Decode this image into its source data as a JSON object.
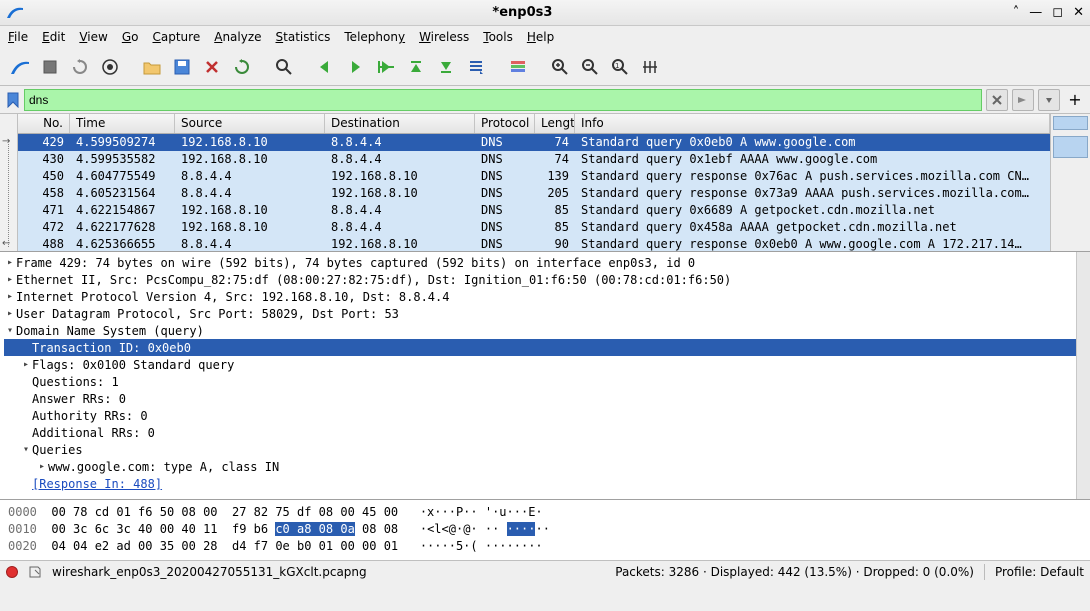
{
  "window": {
    "title": "*enp0s3"
  },
  "menubar": [
    "File",
    "Edit",
    "View",
    "Go",
    "Capture",
    "Analyze",
    "Statistics",
    "Telephony",
    "Wireless",
    "Tools",
    "Help"
  ],
  "filter": {
    "value": "dns"
  },
  "columns": {
    "no": "No.",
    "time": "Time",
    "source": "Source",
    "destination": "Destination",
    "protocol": "Protocol",
    "length": "Length",
    "info": "Info"
  },
  "packets": [
    {
      "no": "429",
      "time": "4.599509274",
      "src": "192.168.8.10",
      "dst": "8.8.4.4",
      "proto": "DNS",
      "len": "74",
      "info": "Standard query 0x0eb0 A www.google.com",
      "sel": true
    },
    {
      "no": "430",
      "time": "4.599535582",
      "src": "192.168.8.10",
      "dst": "8.8.4.4",
      "proto": "DNS",
      "len": "74",
      "info": "Standard query 0x1ebf AAAA www.google.com"
    },
    {
      "no": "450",
      "time": "4.604775549",
      "src": "8.8.4.4",
      "dst": "192.168.8.10",
      "proto": "DNS",
      "len": "139",
      "info": "Standard query response 0x76ac A push.services.mozilla.com CN…"
    },
    {
      "no": "458",
      "time": "4.605231564",
      "src": "8.8.4.4",
      "dst": "192.168.8.10",
      "proto": "DNS",
      "len": "205",
      "info": "Standard query response 0x73a9 AAAA push.services.mozilla.com…"
    },
    {
      "no": "471",
      "time": "4.622154867",
      "src": "192.168.8.10",
      "dst": "8.8.4.4",
      "proto": "DNS",
      "len": "85",
      "info": "Standard query 0x6689 A getpocket.cdn.mozilla.net"
    },
    {
      "no": "472",
      "time": "4.622177628",
      "src": "192.168.8.10",
      "dst": "8.8.4.4",
      "proto": "DNS",
      "len": "85",
      "info": "Standard query 0x458a AAAA getpocket.cdn.mozilla.net"
    },
    {
      "no": "488",
      "time": "4.625366655",
      "src": "8.8.4.4",
      "dst": "192.168.8.10",
      "proto": "DNS",
      "len": "90",
      "info": "Standard query response 0x0eb0 A www.google.com A 172.217.14…"
    }
  ],
  "details": {
    "frame": "Frame 429: 74 bytes on wire (592 bits), 74 bytes captured (592 bits) on interface enp0s3, id 0",
    "eth": "Ethernet II, Src: PcsCompu_82:75:df (08:00:27:82:75:df), Dst: Ignition_01:f6:50 (00:78:cd:01:f6:50)",
    "ip": "Internet Protocol Version 4, Src: 192.168.8.10, Dst: 8.8.4.4",
    "udp": "User Datagram Protocol, Src Port: 58029, Dst Port: 53",
    "dns": "Domain Name System (query)",
    "txid": "Transaction ID: 0x0eb0",
    "flags": "Flags: 0x0100 Standard query",
    "questions": "Questions: 1",
    "answer": "Answer RRs: 0",
    "authority": "Authority RRs: 0",
    "additional": "Additional RRs: 0",
    "queries": "Queries",
    "query1": "www.google.com: type A, class IN",
    "response_in": "[Response In: 488]"
  },
  "hex": {
    "l0_off": "0000",
    "l0_h": "00 78 cd 01 f6 50 08 00  27 82 75 df 08 00 45 00",
    "l0_a": "·x···P·· '·u···E·",
    "l1_off": "0010",
    "l1_h1": "00 3c 6c 3c 40 00 40 11  f9 b6 ",
    "l1_sel": "c0 a8 08 0a",
    "l1_h2": " 08 08",
    "l1_a1": "·<l<@·@· ·· ",
    "l1_asel": "····",
    "l1_a2": "··",
    "l2_off": "0020",
    "l2_h": "04 04 e2 ad 00 35 00 28  d4 f7 0e b0 01 00 00 01",
    "l2_a": "·····5·( ········"
  },
  "status": {
    "file": "wireshark_enp0s3_20200427055131_kGXclt.pcapng",
    "counts": "Packets: 3286 · Displayed: 442 (13.5%) · Dropped: 0 (0.0%)",
    "profile": "Profile: Default"
  }
}
